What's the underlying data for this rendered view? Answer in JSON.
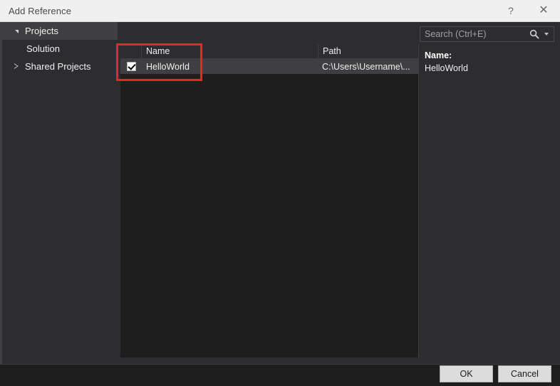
{
  "window": {
    "title": "Add Reference",
    "help_icon": "question-mark-icon",
    "close_icon": "close-x-icon",
    "help_glyph": "?",
    "close_glyph": "✕"
  },
  "sidebar": {
    "items": [
      {
        "label": "Projects",
        "state": "expanded",
        "selected": true,
        "level": 0,
        "arrow": "triangle-down-icon"
      },
      {
        "label": "Solution",
        "state": "leaf",
        "selected": false,
        "level": 1,
        "arrow": ""
      },
      {
        "label": "Shared Projects",
        "state": "collapsed",
        "selected": false,
        "level": 0,
        "arrow": "triangle-right-icon"
      }
    ]
  },
  "search": {
    "placeholder": "Search (Ctrl+E)",
    "value": "",
    "icon": "magnifier-icon",
    "dropdown_icon": "chevron-down-icon"
  },
  "list": {
    "columns": [
      {
        "key": "check",
        "label": ""
      },
      {
        "key": "name",
        "label": "Name"
      },
      {
        "key": "path",
        "label": "Path"
      }
    ],
    "rows": [
      {
        "checked": true,
        "name": "HelloWorld",
        "path": "C:\\Users\\Username\\...",
        "selected": true
      }
    ]
  },
  "details": {
    "label": "Name:",
    "value": "HelloWorld"
  },
  "footer": {
    "ok_label": "OK",
    "cancel_label": "Cancel"
  },
  "annotation": {
    "color": "#e8262a",
    "shape": "rectangle"
  }
}
